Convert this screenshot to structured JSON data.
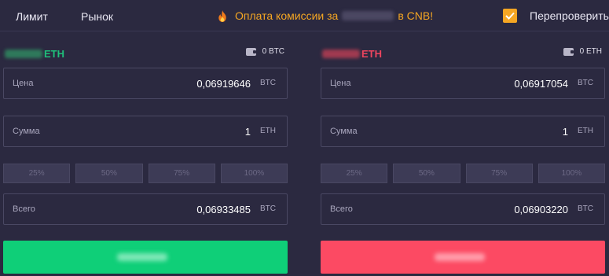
{
  "tabs": {
    "limit": "Лимит",
    "market": "Рынок"
  },
  "promo": {
    "prefix": "Оплата комиссии за",
    "suffix": "в CNB!",
    "color": "#f5a623"
  },
  "recheck": {
    "label": "Перепроверить",
    "checked": true
  },
  "buy": {
    "pair_symbol": "ETH",
    "balance": "0 BTC",
    "price": {
      "label": "Цена",
      "value": "0,06919646",
      "unit": "BTC"
    },
    "amount": {
      "label": "Сумма",
      "value": "1",
      "unit": "ETH"
    },
    "percents": [
      "25%",
      "50%",
      "75%",
      "100%"
    ],
    "total": {
      "label": "Всего",
      "value": "0,06933485",
      "unit": "BTC"
    },
    "button_color": "#0fcf78"
  },
  "sell": {
    "pair_symbol": "ETH",
    "balance": "0 ETH",
    "price": {
      "label": "Цена",
      "value": "0,06917054",
      "unit": "BTC"
    },
    "amount": {
      "label": "Сумма",
      "value": "1",
      "unit": "ETH"
    },
    "percents": [
      "25%",
      "50%",
      "75%",
      "100%"
    ],
    "total": {
      "label": "Всего",
      "value": "0,06903220",
      "unit": "BTC"
    },
    "button_color": "#fc4a63"
  }
}
